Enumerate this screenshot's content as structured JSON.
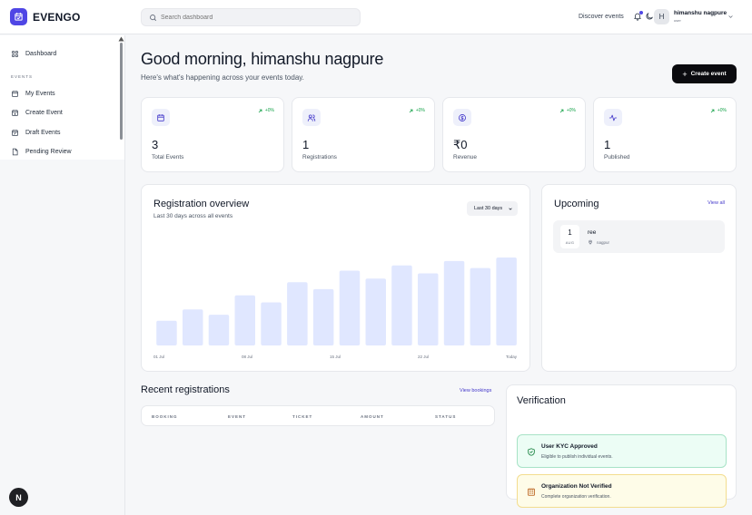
{
  "app": {
    "name": "EVENGO"
  },
  "header": {
    "search_placeholder": "Search dashboard",
    "discover_label": "Discover events",
    "avatar_initial": "H",
    "user_name": "himanshu nagpure",
    "user_role": "user"
  },
  "sidebar": {
    "dashboard": "Dashboard",
    "section_label": "EVENTS",
    "items": [
      "My Events",
      "Create Event",
      "Draft Events",
      "Pending Review"
    ]
  },
  "main": {
    "greeting": "Good morning, himanshu nagpure",
    "subtitle": "Here's what's happening across your events today.",
    "create_button": "Create event"
  },
  "stats": [
    {
      "icon": "calendar-icon",
      "value": "3",
      "label": "Total Events",
      "change": "+0%"
    },
    {
      "icon": "users-icon",
      "value": "1",
      "label": "Registrations",
      "change": "+0%"
    },
    {
      "icon": "currency-icon",
      "value": "₹0",
      "label": "Revenue",
      "change": "+0%"
    },
    {
      "icon": "activity-icon",
      "value": "1",
      "label": "Published",
      "change": "+0%"
    }
  ],
  "registration_overview": {
    "title": "Registration overview",
    "subtitle": "Last 30 days across all events",
    "range_select": "Last 30 days"
  },
  "chart_data": {
    "type": "bar",
    "categories": [
      "01 Jul",
      "",
      "",
      "08 Jul",
      "",
      "",
      "15 Jul",
      "",
      "",
      "22 Jul",
      "",
      "",
      "Today",
      ""
    ],
    "tick_labels": [
      "01 Jul",
      "08 Jul",
      "15 Jul",
      "22 Jul",
      "Today"
    ],
    "values": [
      28,
      41,
      35,
      57,
      49,
      72,
      64,
      85,
      76,
      91,
      82,
      96,
      88,
      100
    ],
    "ylim": [
      0,
      100
    ],
    "bar_color": "#e0e7ff",
    "title": "",
    "xlabel": "",
    "ylabel": ""
  },
  "upcoming": {
    "title": "Upcoming",
    "view_all": "View all",
    "events": [
      {
        "day": "1",
        "month": "AUG",
        "name": "ree",
        "location": "nagpur"
      }
    ]
  },
  "recent": {
    "title": "Recent registrations",
    "view_bookings": "View bookings",
    "columns": [
      "BOOKING",
      "EVENT",
      "TICKET",
      "AMOUNT",
      "STATUS"
    ]
  },
  "verification": {
    "title": "Verification",
    "items": [
      {
        "status": "ok",
        "title": "User KYC Approved",
        "desc": "Eligible to publish individual events."
      },
      {
        "status": "warn",
        "title": "Organization Not Verified",
        "desc": "Complete organization verification."
      }
    ]
  },
  "fab_label": "N",
  "colors": {
    "accent": "#4f46e5",
    "success": "#16a34a",
    "dark": "#0b0b0f"
  }
}
